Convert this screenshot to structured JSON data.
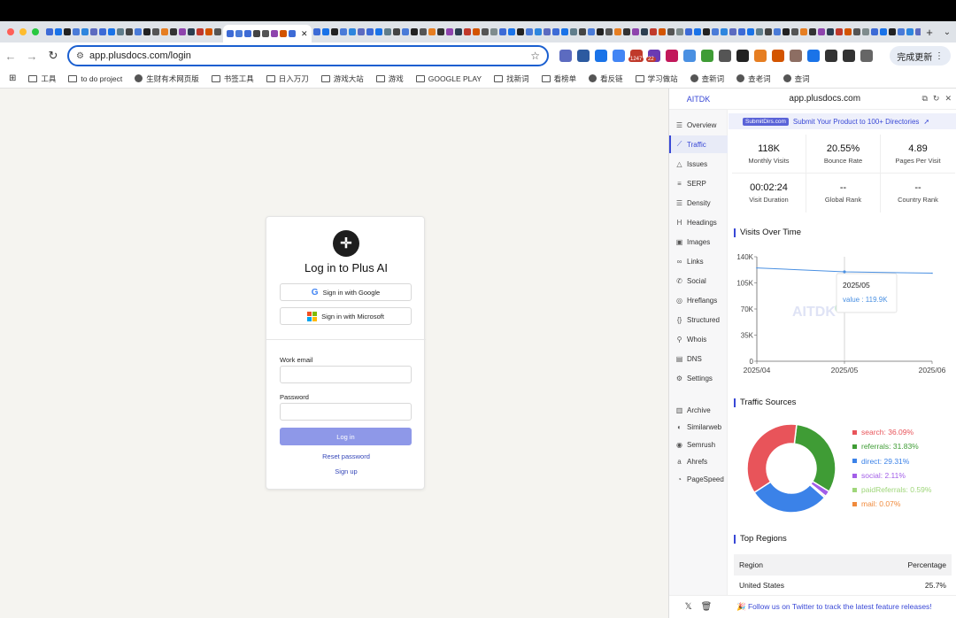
{
  "browser": {
    "url": "app.plusdocs.com/login",
    "update_label": "完成更新",
    "extension_badges": [
      "1247",
      "22"
    ],
    "bookmarks": [
      {
        "label": "工具",
        "icon": "folder-icon"
      },
      {
        "label": "to do project",
        "icon": "folder-icon"
      },
      {
        "label": "生财有术网页版",
        "icon": "globe-icon"
      },
      {
        "label": "书签工具",
        "icon": "folder-icon"
      },
      {
        "label": "日入万刀",
        "icon": "folder-icon"
      },
      {
        "label": "游戏大站",
        "icon": "folder-icon"
      },
      {
        "label": "游戏",
        "icon": "folder-icon"
      },
      {
        "label": "GOOGLE PLAY",
        "icon": "folder-icon"
      },
      {
        "label": "找新词",
        "icon": "folder-icon"
      },
      {
        "label": "看榜单",
        "icon": "folder-icon"
      },
      {
        "label": "看反链",
        "icon": "globe-icon"
      },
      {
        "label": "学习做站",
        "icon": "folder-icon"
      },
      {
        "label": "查新词",
        "icon": "globe-icon"
      },
      {
        "label": "查老词",
        "icon": "globe-icon"
      },
      {
        "label": "查词",
        "icon": "globe-icon"
      }
    ]
  },
  "login": {
    "title": "Log in to Plus AI",
    "google_label": "Sign in with Google",
    "microsoft_label": "Sign in with Microsoft",
    "email_label": "Work email",
    "email_value": "",
    "password_label": "Password",
    "password_value": "",
    "login_label": "Log in",
    "reset_label": "Reset password",
    "signup_label": "Sign up"
  },
  "panel": {
    "brand": "AITDK",
    "domain": "app.plusdocs.com",
    "nav": [
      {
        "label": "Overview",
        "icon": "list-icon"
      },
      {
        "label": "Traffic",
        "icon": "line-chart-icon",
        "active": true
      },
      {
        "label": "Issues",
        "icon": "warning-icon"
      },
      {
        "label": "SERP",
        "icon": "serp-icon"
      },
      {
        "label": "Density",
        "icon": "density-icon"
      },
      {
        "label": "Headings",
        "icon": "heading-icon"
      },
      {
        "label": "Images",
        "icon": "image-icon"
      },
      {
        "label": "Links",
        "icon": "link-icon"
      },
      {
        "label": "Social",
        "icon": "social-icon"
      },
      {
        "label": "Hreflangs",
        "icon": "globe-icon"
      },
      {
        "label": "Structured",
        "icon": "braces-icon"
      },
      {
        "label": "Whois",
        "icon": "search-icon"
      },
      {
        "label": "DNS",
        "icon": "server-icon"
      },
      {
        "label": "Settings",
        "icon": "gear-icon"
      }
    ],
    "tools": [
      {
        "label": "Archive",
        "icon": "archive-icon"
      },
      {
        "label": "Similarweb",
        "icon": "similarweb-icon"
      },
      {
        "label": "Semrush",
        "icon": "semrush-icon"
      },
      {
        "label": "Ahrefs",
        "icon": "ahrefs-icon"
      },
      {
        "label": "PageSpeed",
        "icon": "pagespeed-icon"
      }
    ],
    "promo": {
      "tag": "SubmitDirs.com",
      "text": "Submit Your Product to 100+ Directories"
    },
    "stats": [
      {
        "value": "118K",
        "label": "Monthly Visits"
      },
      {
        "value": "20.55%",
        "label": "Bounce Rate"
      },
      {
        "value": "4.89",
        "label": "Pages Per Visit"
      },
      {
        "value": "00:02:24",
        "label": "Visit Duration"
      },
      {
        "value": "--",
        "label": "Global Rank"
      },
      {
        "value": "--",
        "label": "Country Rank"
      }
    ],
    "visits_title": "Visits Over Time",
    "sources_title": "Traffic Sources",
    "regions_title": "Top Regions",
    "regions_headers": [
      "Region",
      "Percentage"
    ],
    "regions": [
      {
        "region": "United States",
        "pct": "25.7%"
      }
    ],
    "footer_msg": "🎉 Follow us on Twitter to track the latest feature releases!",
    "tooltip": {
      "x": "2025/05",
      "text": "value : 119.9K"
    },
    "watermark": "AITDK"
  },
  "chart_data": [
    {
      "type": "line",
      "x": [
        "2025/04",
        "2025/05",
        "2025/06"
      ],
      "series": [
        {
          "values": [
            125000,
            119900,
            118000
          ]
        }
      ],
      "ylim": [
        0,
        140000
      ],
      "yticks": [
        "0",
        "35K",
        "70K",
        "105K",
        "140K"
      ],
      "grid": false,
      "color": "#4a90e2"
    },
    {
      "type": "pie",
      "labels": [
        "search",
        "referrals",
        "direct",
        "social",
        "paidReferrals",
        "mail"
      ],
      "values": [
        36.09,
        31.83,
        29.31,
        2.11,
        0.59,
        0.07
      ],
      "display": [
        "search: 36.09%",
        "referrals: 31.83%",
        "direct: 29.31%",
        "social: 2.11%",
        "paidReferrals: 0.59%",
        "mail: 0.07%"
      ],
      "colors": [
        "#e8545a",
        "#3f9c35",
        "#3b82e8",
        "#a25ee8",
        "#9fd67a",
        "#f08a3c"
      ]
    }
  ]
}
